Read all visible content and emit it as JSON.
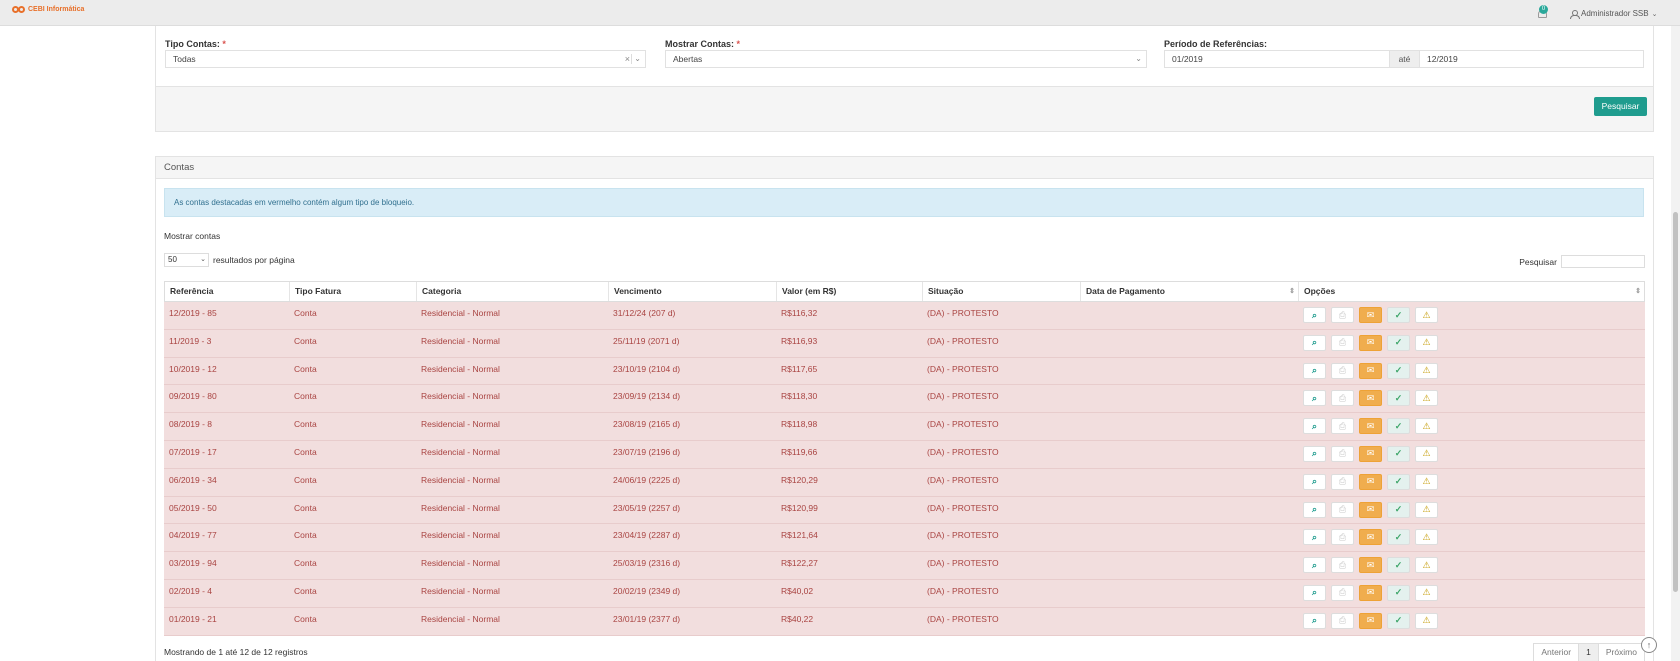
{
  "topbar": {
    "brand": "CEBI Informática",
    "notification_count": "0",
    "user_name": "Administrador SSB"
  },
  "filters": {
    "tipo_contas": {
      "label": "Tipo Contas:",
      "required_mark": "*",
      "value": "Todas"
    },
    "mostrar_contas": {
      "label": "Mostrar Contas:",
      "required_mark": "*",
      "value": "Abertas"
    },
    "periodo": {
      "label": "Período de Referências:",
      "from": "01/2019",
      "separator": "até",
      "to": "12/2019"
    },
    "search_button": "Pesquisar"
  },
  "contas": {
    "title": "Contas",
    "alert": "As contas destacadas em vermelho contém algum tipo de bloqueio.",
    "show_label": "Mostrar contas",
    "page_length": "50",
    "per_page_label": "resultados por página",
    "search_label": "Pesquisar",
    "columns": [
      "Referência",
      "Tipo Fatura",
      "Categoria",
      "Vencimento",
      "Valor (em R$)",
      "Situação",
      "Data de Pagamento",
      "Opções"
    ],
    "rows": [
      {
        "ref": "12/2019 - 85",
        "tipo": "Conta",
        "categoria": "Residencial - Normal",
        "vencimento": "31/12/24 (207 d)",
        "valor": "R$116,32",
        "situacao": "(DA) - PROTESTO",
        "pagamento": ""
      },
      {
        "ref": "11/2019 - 3",
        "tipo": "Conta",
        "categoria": "Residencial - Normal",
        "vencimento": "25/11/19 (2071 d)",
        "valor": "R$116,93",
        "situacao": "(DA) - PROTESTO",
        "pagamento": ""
      },
      {
        "ref": "10/2019 - 12",
        "tipo": "Conta",
        "categoria": "Residencial - Normal",
        "vencimento": "23/10/19 (2104 d)",
        "valor": "R$117,65",
        "situacao": "(DA) - PROTESTO",
        "pagamento": ""
      },
      {
        "ref": "09/2019 - 80",
        "tipo": "Conta",
        "categoria": "Residencial - Normal",
        "vencimento": "23/09/19 (2134 d)",
        "valor": "R$118,30",
        "situacao": "(DA) - PROTESTO",
        "pagamento": ""
      },
      {
        "ref": "08/2019 - 8",
        "tipo": "Conta",
        "categoria": "Residencial - Normal",
        "vencimento": "23/08/19 (2165 d)",
        "valor": "R$118,98",
        "situacao": "(DA) - PROTESTO",
        "pagamento": ""
      },
      {
        "ref": "07/2019 - 17",
        "tipo": "Conta",
        "categoria": "Residencial - Normal",
        "vencimento": "23/07/19 (2196 d)",
        "valor": "R$119,66",
        "situacao": "(DA) - PROTESTO",
        "pagamento": ""
      },
      {
        "ref": "06/2019 - 34",
        "tipo": "Conta",
        "categoria": "Residencial - Normal",
        "vencimento": "24/06/19 (2225 d)",
        "valor": "R$120,29",
        "situacao": "(DA) - PROTESTO",
        "pagamento": ""
      },
      {
        "ref": "05/2019 - 50",
        "tipo": "Conta",
        "categoria": "Residencial - Normal",
        "vencimento": "23/05/19 (2257 d)",
        "valor": "R$120,99",
        "situacao": "(DA) - PROTESTO",
        "pagamento": ""
      },
      {
        "ref": "04/2019 - 77",
        "tipo": "Conta",
        "categoria": "Residencial - Normal",
        "vencimento": "23/04/19 (2287 d)",
        "valor": "R$121,64",
        "situacao": "(DA) - PROTESTO",
        "pagamento": ""
      },
      {
        "ref": "03/2019 - 94",
        "tipo": "Conta",
        "categoria": "Residencial - Normal",
        "vencimento": "25/03/19 (2316 d)",
        "valor": "R$122,27",
        "situacao": "(DA) - PROTESTO",
        "pagamento": ""
      },
      {
        "ref": "02/2019 - 4",
        "tipo": "Conta",
        "categoria": "Residencial - Normal",
        "vencimento": "20/02/19 (2349 d)",
        "valor": "R$40,02",
        "situacao": "(DA) - PROTESTO",
        "pagamento": ""
      },
      {
        "ref": "01/2019 - 21",
        "tipo": "Conta",
        "categoria": "Residencial - Normal",
        "vencimento": "23/01/19 (2377 d)",
        "valor": "R$40,22",
        "situacao": "(DA) - PROTESTO",
        "pagamento": ""
      }
    ],
    "footer_info": "Mostrando de 1 até 12 de 12 registros",
    "pager": {
      "prev": "Anterior",
      "current": "1",
      "next": "Próximo"
    }
  },
  "icons": {
    "view": "search-icon",
    "print": "print-icon",
    "email": "envelope-icon",
    "pay": "check-icon",
    "warning": "warning-icon"
  },
  "colors": {
    "brand": "#e8702a",
    "primary": "#1f9c8e",
    "blocked_row_bg": "#f2dede",
    "blocked_row_text": "#a94442",
    "alert_bg": "#d9edf7"
  }
}
